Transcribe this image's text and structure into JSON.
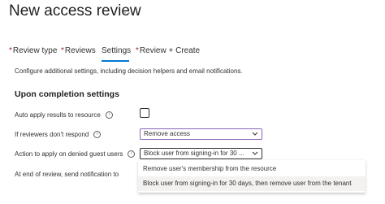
{
  "header": {
    "title": "New access review",
    "more_label": "···"
  },
  "tabs": [
    {
      "label": "Review type",
      "required": true,
      "active": false
    },
    {
      "label": "Reviews",
      "required": true,
      "active": false
    },
    {
      "label": "Settings",
      "required": false,
      "active": true
    },
    {
      "label": "Review + Create",
      "required": true,
      "active": false
    }
  ],
  "required_marker": "*",
  "description": "Configure additional settings, including decision helpers and email notifications.",
  "section_title": "Upon completion settings",
  "info_icon": "i",
  "settings": {
    "auto_apply": {
      "label": "Auto apply results to resource",
      "checked": false
    },
    "no_response": {
      "label": "If reviewers don't respond",
      "value": "Remove access"
    },
    "denied_guest": {
      "label": "Action to apply on denied guest users",
      "value": "Block user from signing-in for 30 ..."
    },
    "notification": {
      "label": "At end of review, send notification to"
    }
  },
  "denied_guest_options": [
    {
      "label": "Remove user's membership from the resource",
      "selected": false
    },
    {
      "label": "Block user from signing-in for 30 days, then remove user from the tenant",
      "selected": true
    }
  ],
  "colors": {
    "accent": "#0078d4",
    "required": "#a4262c",
    "focus_border": "#8764b8"
  }
}
